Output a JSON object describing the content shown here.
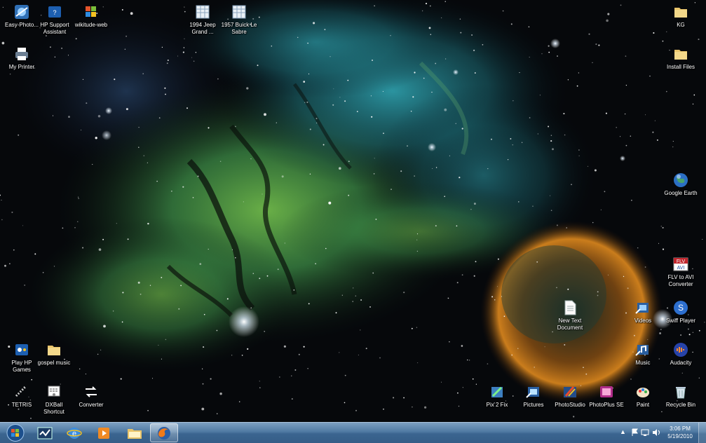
{
  "desktop_icons": {
    "easy_photo": "Easy-Photo...",
    "hp_support": "HP Support\nAssistant",
    "wikitude": "wikitude-web",
    "jeep": "1994 Jeep\nGrand ...",
    "buick": "1957 Buick Le\nSabre",
    "kg": "KG",
    "my_printer": "My Printer",
    "install_files": "Install Files",
    "google_earth": "Google Earth",
    "flv_to_avi": "FLV to AVI\nConverter",
    "new_text_document": "New Text\nDocument",
    "videos": "Videos",
    "swiff_player": "Swiff Player",
    "play_hp_games": "Play HP\nGames",
    "gospel_music": "gospel music",
    "music": "Music",
    "audacity": "Audacity",
    "tetris": "TETRIS",
    "dxball": "DXBall\nShortcut",
    "converter": "Converter",
    "pix2fix": "Pix 2 Fix",
    "pictures": "Pictures",
    "photostudio": "PhotoStudio",
    "photoplus": "PhotoPlus SE",
    "paint": "Paint",
    "recycle_bin": "Recycle Bin"
  },
  "taskbar": {
    "time": "3:06 PM",
    "date": "5/19/2010",
    "buttons": [
      "start",
      "task-manager",
      "internet-explorer",
      "media-player",
      "windows-explorer",
      "firefox"
    ],
    "active_button": "firefox"
  },
  "colors": {
    "taskbar_top": "#7c9fc1",
    "taskbar_bottom": "#355d87",
    "nebula_green": "#4d9a4a",
    "nebula_cyan": "#2a8f9a",
    "nebula_orange": "#d9851c"
  }
}
